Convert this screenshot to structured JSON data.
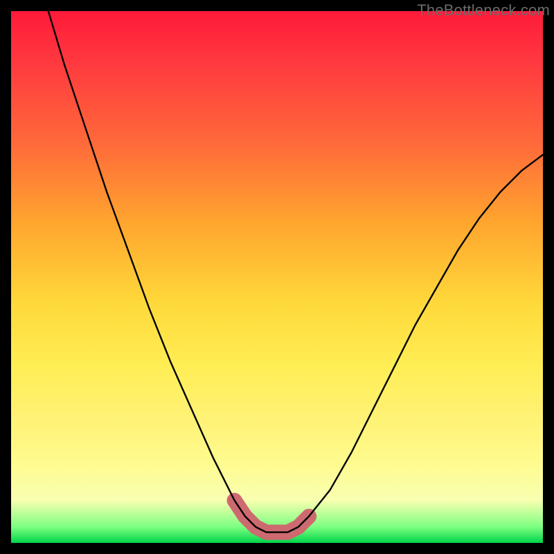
{
  "watermark": "TheBottleneck.com",
  "chart_data": {
    "type": "line",
    "title": "",
    "xlabel": "",
    "ylabel": "",
    "xlim": [
      0,
      100
    ],
    "ylim": [
      0,
      100
    ],
    "series": [
      {
        "name": "bottleneck-curve",
        "x": [
          7,
          10,
          14,
          18,
          22,
          26,
          30,
          34,
          38,
          40,
          42,
          44,
          46,
          48,
          50,
          52,
          54,
          56,
          60,
          64,
          68,
          72,
          76,
          80,
          84,
          88,
          92,
          96,
          100
        ],
        "y": [
          100,
          90,
          78,
          66,
          55,
          44,
          34,
          25,
          16,
          12,
          8,
          5,
          3,
          2,
          2,
          2,
          3,
          5,
          10,
          17,
          25,
          33,
          41,
          48,
          55,
          61,
          66,
          70,
          73
        ]
      },
      {
        "name": "optimal-fit-region",
        "x": [
          42,
          44,
          46,
          48,
          50,
          52,
          54,
          56
        ],
        "y": [
          8,
          5,
          3,
          2,
          2,
          2,
          3,
          5
        ]
      }
    ],
    "gradient_stops": [
      {
        "pos": 0,
        "color": "#ff1a3a"
      },
      {
        "pos": 10,
        "color": "#ff3a3f"
      },
      {
        "pos": 25,
        "color": "#ff6a3a"
      },
      {
        "pos": 40,
        "color": "#ffa62e"
      },
      {
        "pos": 55,
        "color": "#ffd93a"
      },
      {
        "pos": 67,
        "color": "#ffee55"
      },
      {
        "pos": 75,
        "color": "#fff170"
      },
      {
        "pos": 85,
        "color": "#fffb8f"
      },
      {
        "pos": 92,
        "color": "#f8ffb0"
      },
      {
        "pos": 97,
        "color": "#7cff80"
      },
      {
        "pos": 100,
        "color": "#00d44a"
      }
    ]
  }
}
